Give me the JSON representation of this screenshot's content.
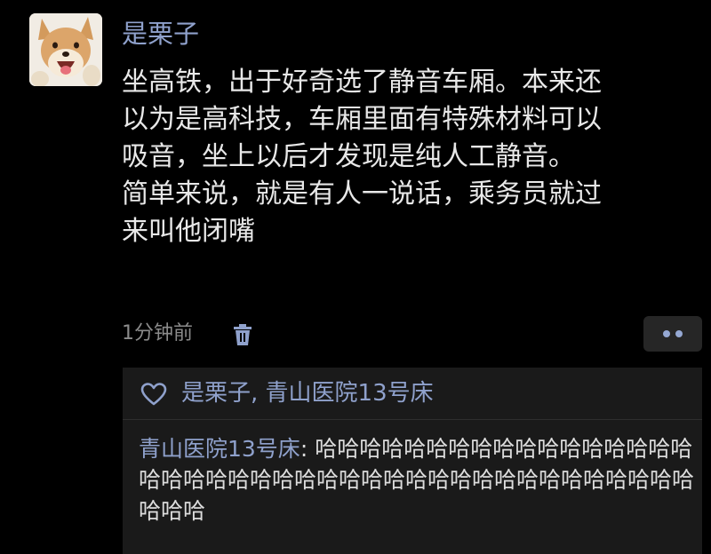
{
  "post": {
    "username": "是栗子",
    "lines": [
      "坐高铁，出于好奇选了静音车厢。本来还",
      "以为是高科技，车厢里面有特殊材料可以",
      "吸音，坐上以后才发现是纯人工静音。",
      "简单来说，就是有人一说话，乘务员就过",
      "来叫他闭嘴"
    ],
    "timestamp": "1分钟前",
    "avatar_icon": "shiba-dog-avatar",
    "delete_icon": "trash-icon",
    "more_icon": "more-dots-icon"
  },
  "likes": {
    "icon": "heart-icon",
    "names": "是栗子, 青山医院13号床"
  },
  "comments": [
    {
      "author": "青山医院13号床",
      "separator": ": ",
      "text": "哈哈哈哈哈哈哈哈哈哈哈哈哈哈哈哈哈哈哈哈哈哈哈哈哈哈哈哈哈哈哈哈哈哈哈哈哈哈哈哈哈哈哈哈哈"
    }
  ],
  "colors": {
    "background": "#000000",
    "name_link": "#8fa1cc",
    "body_text": "#e8e8e8",
    "meta_text": "#8b8b8b",
    "panel": "#1a1a1a"
  }
}
